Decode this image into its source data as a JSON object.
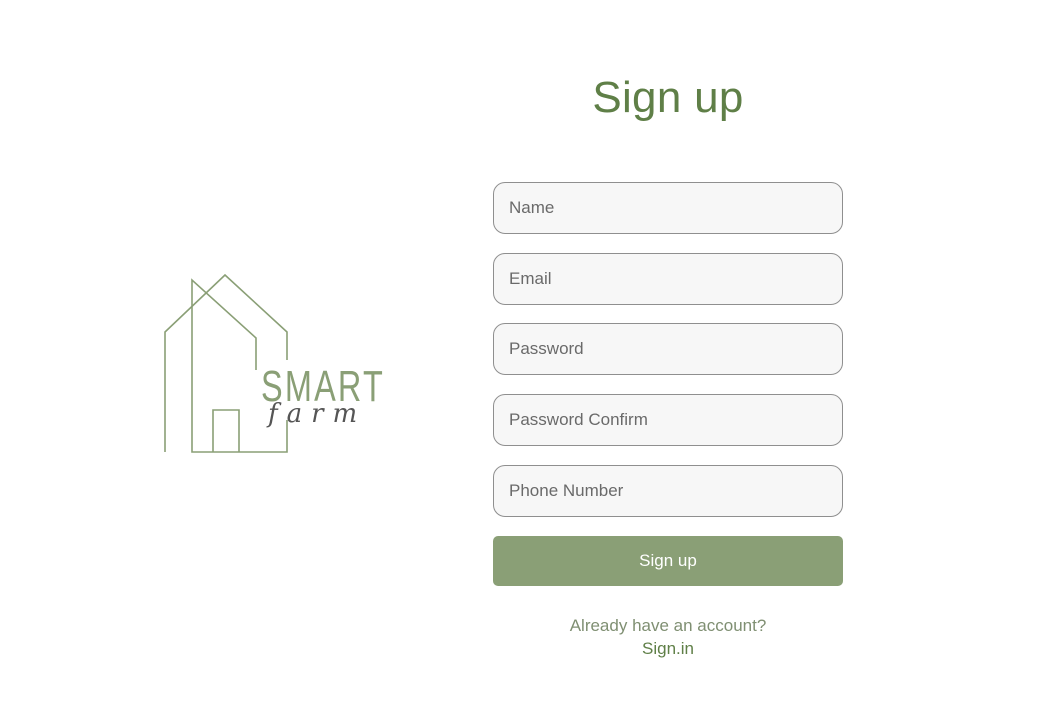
{
  "brand": {
    "logo_word": "SMART",
    "logo_script": "farm"
  },
  "form": {
    "title": "Sign up",
    "fields": [
      {
        "placeholder": "Name",
        "value": ""
      },
      {
        "placeholder": "Email",
        "value": ""
      },
      {
        "placeholder": "Password",
        "value": ""
      },
      {
        "placeholder": "Password Confirm",
        "value": ""
      },
      {
        "placeholder": "Phone Number",
        "value": ""
      }
    ],
    "submit_label": "Sign up",
    "account_prompt": "Already have an account?",
    "signin_label": "Sign.in"
  },
  "colors": {
    "brand_green": "#5f7f47",
    "button_green": "#8a9f76",
    "logo_line": "#8a9f76",
    "logo_script": "#555555"
  }
}
